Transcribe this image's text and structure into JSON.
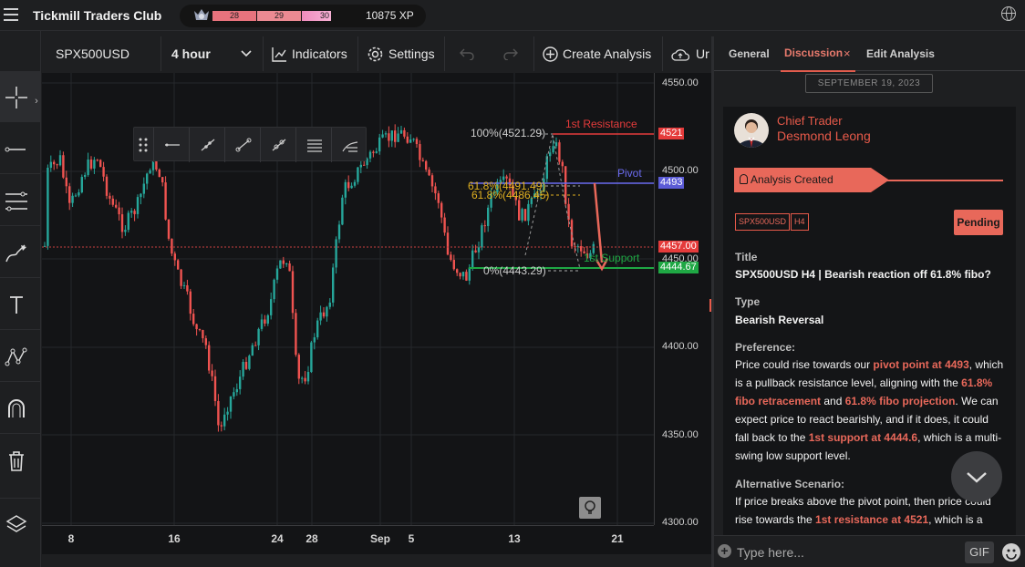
{
  "topbar": {
    "title": "Tickmill Traders Club",
    "levels": [
      "28",
      "29",
      "30"
    ],
    "xp": "10875 XP"
  },
  "chart_toolbar": {
    "symbol": "SPX500USD",
    "timeframe": "4 hour",
    "indicators": "Indicators",
    "settings": "Settings",
    "create_analysis": "Create Analysis",
    "cut_label": "Ur"
  },
  "price_axis": {
    "ticks": [
      "4550.00",
      "4500.00",
      "4450.00",
      "4400.00",
      "4350.00",
      "4300.00"
    ],
    "markers": [
      {
        "text": "4521",
        "color": "#e53b3b"
      },
      {
        "text": "4493",
        "color": "#5b5bd6"
      },
      {
        "text": "4457.00",
        "color": "#e53b3b"
      },
      {
        "text": "4444.67",
        "color": "#1fa844"
      }
    ]
  },
  "time_axis": {
    "ticks": [
      "8",
      "16",
      "24",
      "28",
      "Sep",
      "5",
      "13",
      "21"
    ]
  },
  "annotations": {
    "resistance": "1st Resistance",
    "pivot": "Pivot",
    "support": "1st Support",
    "fib100": "100%(4521.29)",
    "fib618a": "61.8%(4491.49)",
    "fib618b": "61.8%(4486.45)",
    "fib0": "0%(4443.29)"
  },
  "panel": {
    "tabs": [
      "General",
      "Discussion",
      "Edit Analysis"
    ],
    "close_glyph": "×",
    "date": "SEPTEMBER 19, 2023",
    "author_role": "Chief Trader",
    "author_name": "Desmond Leong",
    "banner": "Analysis Created",
    "tags": [
      "SPX500USD",
      "H4"
    ],
    "status": "Pending",
    "title_label": "Title",
    "title_value": "SPX500USD H4 | Bearish reaction off 61.8% fibo?",
    "type_label": "Type",
    "type_value": "Bearish Reversal",
    "pref_label": "Preference:",
    "pref": {
      "t1": "Price could rise towards our ",
      "h1": "pivot point at 4493",
      "t2": ", which is a pullback resistance level, aligning with the ",
      "h2": "61.8% fibo retracement",
      "t3": " and ",
      "h3": "61.8% fibo projection",
      "t4": ". We can expect price to react bearishly, and if it does, it could fall back to the ",
      "h4": "1st support at 4444.6",
      "t5": ", which is a multi-swing low support level."
    },
    "alt_label": "Alternative Scenario:",
    "alt": {
      "t1": "If price breaks above the pivot point, then price could rise towards the ",
      "h1": "1st resistance at 4521",
      "t2": ", which is a"
    },
    "input_placeholder": "Type here...",
    "gif": "GIF"
  }
}
